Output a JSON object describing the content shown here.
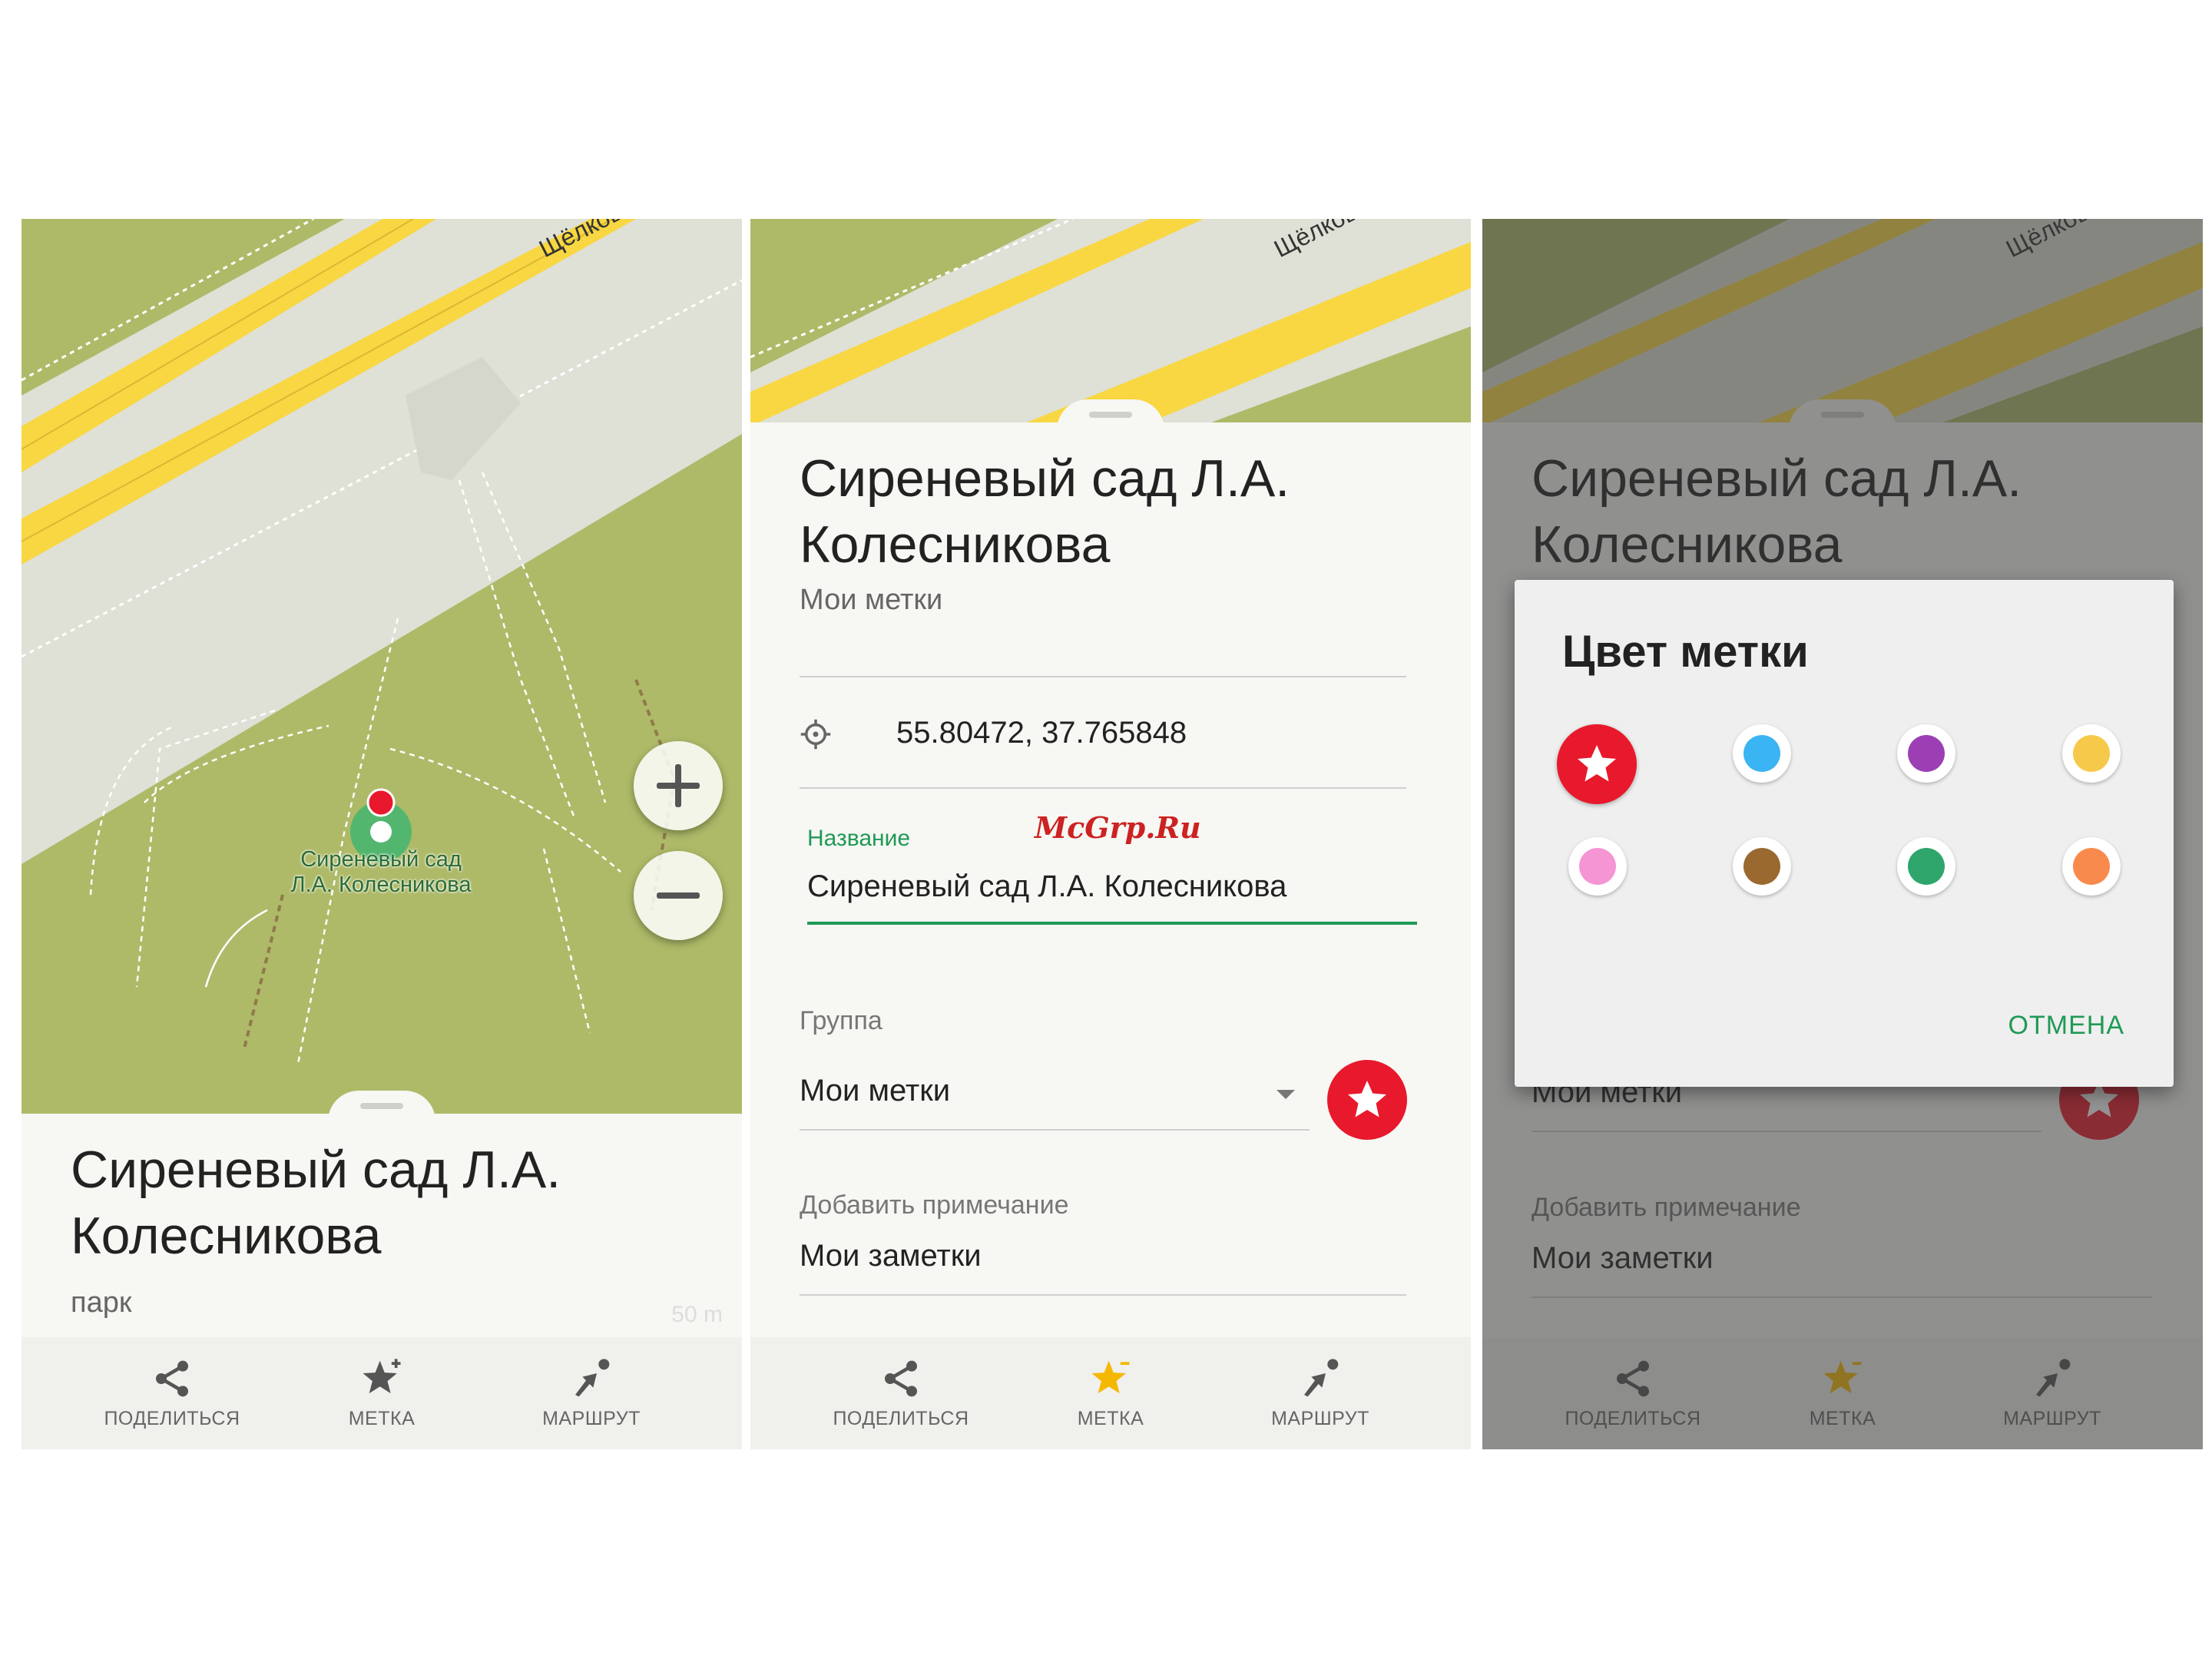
{
  "map": {
    "street_label": "Щёлковск",
    "poi_label_line1": "Сиреневый сад",
    "poi_label_line2": "Л.А. Колесникова",
    "scale": "50 m"
  },
  "place": {
    "name_line1": "Сиреневый сад Л.А.",
    "name_line2": "Колесникова",
    "type": "парк",
    "group_subtitle": "Мои метки"
  },
  "actions": {
    "share": "ПОДЕЛИТЬСЯ",
    "bookmark": "МЕТКА",
    "route": "МАРШРУТ"
  },
  "edit_form": {
    "coordinates": "55.80472, 37.765848",
    "name_label": "Название",
    "name_value": "Сиреневый сад Л.А. Колесникова",
    "group_label": "Группа",
    "group_value": "Мои метки",
    "note_label": "Добавить примечание",
    "note_value": "Мои заметки"
  },
  "color_dialog": {
    "title": "Цвет метки",
    "colors": [
      "#e8192c",
      "#3ab4f2",
      "#9c3fb5",
      "#f7c94a",
      "#f595d3",
      "#99692f",
      "#2ea66b",
      "#f98a4d"
    ],
    "cancel": "ОТМЕНА"
  },
  "watermark": "McGrp.Ru",
  "colors": {
    "accent_green": "#1f9a56",
    "accent_red": "#e8192c",
    "star_active": "#f5b800",
    "park": "#aeba68",
    "road": "#f8d743"
  }
}
